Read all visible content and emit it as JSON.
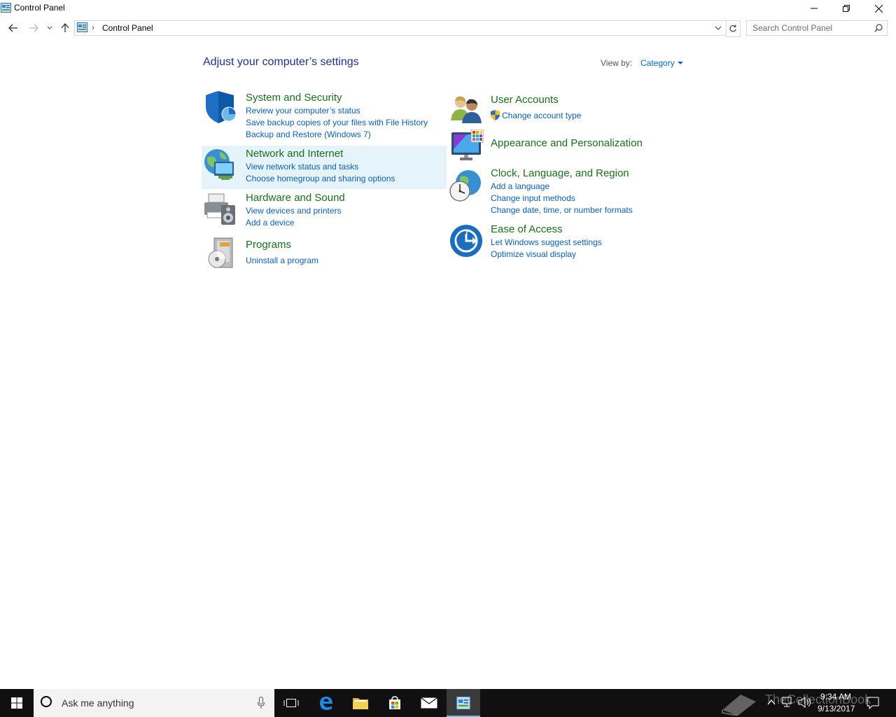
{
  "window": {
    "title": "Control Panel",
    "controls": {
      "minimize": "minimize",
      "restore": "restore",
      "close": "close"
    }
  },
  "address": {
    "breadcrumb": "Control Panel",
    "separator": "›"
  },
  "search": {
    "placeholder": "Search Control Panel"
  },
  "main": {
    "heading": "Adjust your computer’s settings",
    "view_by_label": "View by:",
    "view_by_value": "Category"
  },
  "categories": [
    {
      "title": "System and Security",
      "icon": "shield-icon",
      "links": [
        "Review your computer’s status",
        "Save backup copies of your files with File History",
        "Backup and Restore (Windows 7)"
      ]
    },
    {
      "title": "Network and Internet",
      "icon": "network-globe-icon",
      "links": [
        "View network status and tasks",
        "Choose homegroup and sharing options"
      ]
    },
    {
      "title": "Hardware and Sound",
      "icon": "printer-speaker-icon",
      "links": [
        "View devices and printers",
        "Add a device"
      ]
    },
    {
      "title": "Programs",
      "icon": "programs-disc-icon",
      "links": [
        "Uninstall a program"
      ]
    },
    {
      "title": "User Accounts",
      "icon": "users-icon",
      "links": [
        "Change account type"
      ]
    },
    {
      "title": "Appearance and Personalization",
      "icon": "monitor-palette-icon",
      "links": []
    },
    {
      "title": "Clock, Language, and Region",
      "icon": "clock-globe-icon",
      "links": [
        "Add a language",
        "Change input methods",
        "Change date, time, or number formats"
      ]
    },
    {
      "title": "Ease of Access",
      "icon": "ease-of-access-icon",
      "links": [
        "Let Windows suggest settings",
        "Optimize visual display"
      ]
    }
  ],
  "taskbar": {
    "cortana_placeholder": "Ask me anything",
    "time": "9:34 AM",
    "date": "9/13/2017",
    "watermark": "TheCollectionBook"
  },
  "colors": {
    "heading": "#1e3287",
    "category_title": "#1a6e1a",
    "link": "#0b5fb3",
    "hover_bg": "#e5f3fb",
    "taskbar": "#101010"
  }
}
